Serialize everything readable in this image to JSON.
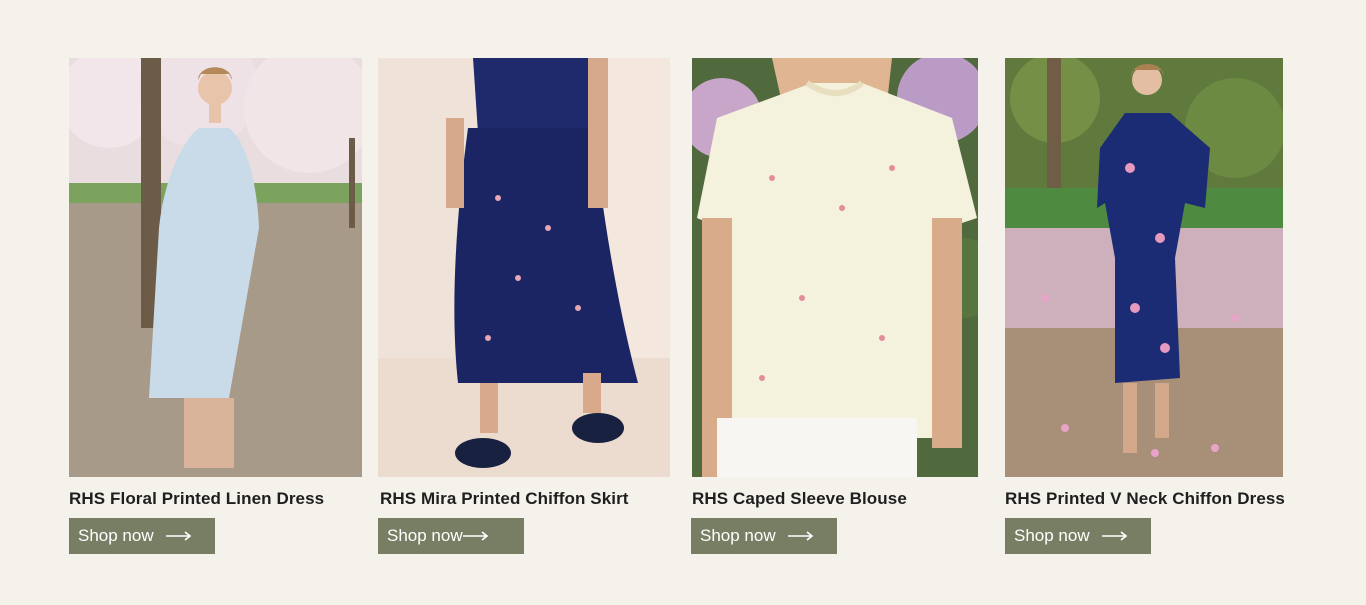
{
  "products": [
    {
      "title": "RHS Floral Printed Linen Dress",
      "cta": "Shop now",
      "arrow_icon": "right-arrow-icon"
    },
    {
      "title": "RHS Mira Printed Chiffon Skirt",
      "cta": "Shop now",
      "arrow_icon": "right-arrow-icon"
    },
    {
      "title": "RHS Caped Sleeve Blouse",
      "cta": "Shop now",
      "arrow_icon": "right-arrow-icon"
    },
    {
      "title": "RHS Printed V Neck Chiffon Dress",
      "cta": "Shop now",
      "arrow_icon": "right-arrow-icon"
    }
  ],
  "colors": {
    "page_background": "#f5f2ec",
    "button_background": "#787e64",
    "button_text": "#ffffff",
    "title_text": "#1f1f1f"
  }
}
